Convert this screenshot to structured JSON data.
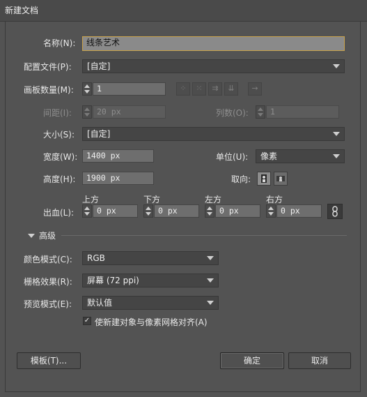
{
  "window": {
    "title": "新建文档"
  },
  "form": {
    "name": {
      "label": "名称(N):",
      "value": "线条艺术"
    },
    "profile": {
      "label": "配置文件(P):",
      "value": "[自定]"
    },
    "artboards": {
      "label": "画板数量(M):",
      "value": "1"
    },
    "spacing": {
      "label": "间距(I):",
      "value": "20 px"
    },
    "columns": {
      "label": "列数(O):",
      "value": "1"
    },
    "size": {
      "label": "大小(S):",
      "value": "[自定]"
    },
    "width": {
      "label": "宽度(W):",
      "value": "1400 px"
    },
    "units": {
      "label": "单位(U):",
      "value": "像素"
    },
    "height": {
      "label": "高度(H):",
      "value": "1900 px"
    },
    "orientation": {
      "label": "取向:"
    },
    "bleed": {
      "label": "出血(L):",
      "top": {
        "label": "上方",
        "value": "0 px"
      },
      "bottom": {
        "label": "下方",
        "value": "0 px"
      },
      "left": {
        "label": "左方",
        "value": "0 px"
      },
      "right": {
        "label": "右方",
        "value": "0 px"
      }
    }
  },
  "advanced": {
    "header": "高级",
    "color_mode": {
      "label": "颜色模式(C):",
      "value": "RGB"
    },
    "raster": {
      "label": "栅格效果(R):",
      "value": "屏幕 (72 ppi)"
    },
    "preview": {
      "label": "预览模式(E):",
      "value": "默认值"
    },
    "align_pixel": {
      "label": "使新建对象与像素网格对齐(A)",
      "checked": true
    }
  },
  "buttons": {
    "templates": "模板(T)...",
    "ok": "确定",
    "cancel": "取消"
  },
  "colors": {
    "background": "#535353",
    "field": "#6e6e6e",
    "focus": "#c9a24a"
  }
}
